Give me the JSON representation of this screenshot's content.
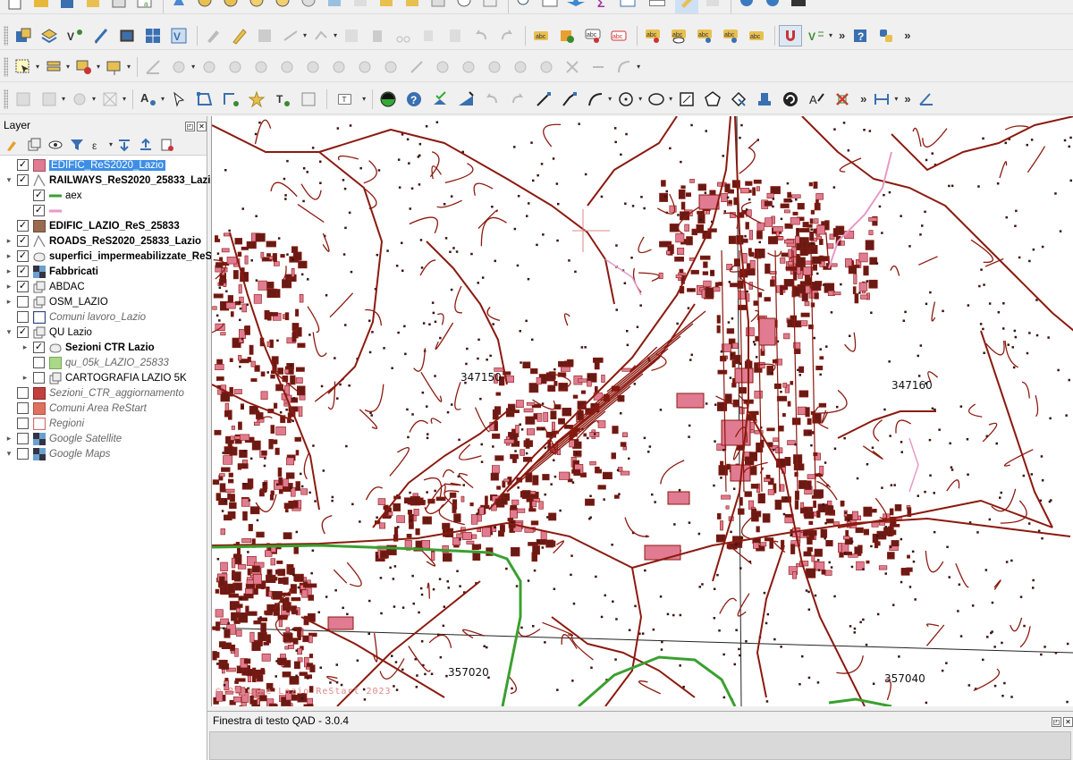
{
  "layer_panel": {
    "title": "Layer",
    "tools": [
      "style-manager-icon",
      "add-group-icon",
      "visibility-icon",
      "filter-legend-icon",
      "expression-filter-icon",
      "expand-all-icon",
      "collapse-all-icon",
      "remove-layer-icon"
    ],
    "layers": [
      {
        "name": "EDIFIC_ReS2020_Lazio",
        "checked": true,
        "expand": "",
        "symbol": "fill-pink",
        "style": "selected",
        "indent": 0
      },
      {
        "name": "RAILWAYS_ReS2020_25833_Lazio",
        "checked": true,
        "expand": "▾",
        "symbol": "line",
        "style": "bold",
        "indent": 0
      },
      {
        "name": "aex",
        "checked": true,
        "expand": "",
        "symbol": "line-green",
        "style": "",
        "indent": 1
      },
      {
        "name": "",
        "checked": true,
        "expand": "",
        "symbol": "line-pink",
        "style": "",
        "indent": 1
      },
      {
        "name": "EDIFIC_LAZIO_ReS_25833",
        "checked": true,
        "expand": "",
        "symbol": "fill-brown",
        "style": "bold",
        "indent": 0
      },
      {
        "name": "ROADS_ReS2020_25833_Lazio",
        "checked": true,
        "expand": "▸",
        "symbol": "line",
        "style": "bold",
        "indent": 0
      },
      {
        "name": "superfici_impermeabilizzate_ReS",
        "checked": true,
        "expand": "▸",
        "symbol": "polygon",
        "style": "bold",
        "indent": 0
      },
      {
        "name": "Fabbricati",
        "checked": true,
        "expand": "▸",
        "symbol": "raster",
        "style": "bold",
        "indent": 0
      },
      {
        "name": "ABDAC",
        "checked": true,
        "expand": "▸",
        "symbol": "group",
        "style": "",
        "indent": 0
      },
      {
        "name": "OSM_LAZIO",
        "checked": false,
        "expand": "▸",
        "symbol": "group",
        "style": "",
        "indent": 0
      },
      {
        "name": "Comuni lavoro_Lazio",
        "checked": false,
        "expand": "",
        "symbol": "fill-outline-blue",
        "style": "italic",
        "indent": 0
      },
      {
        "name": "QU Lazio",
        "checked": true,
        "expand": "▾",
        "symbol": "group",
        "style": "",
        "indent": 0
      },
      {
        "name": "Sezioni CTR Lazio",
        "checked": true,
        "expand": "▸",
        "symbol": "polygon",
        "style": "bold",
        "indent": 1
      },
      {
        "name": "qu_05k_LAZIO_25833",
        "checked": false,
        "expand": "",
        "symbol": "fill-green",
        "style": "italic",
        "indent": 1
      },
      {
        "name": "CARTOGRAFIA LAZIO 5K",
        "checked": false,
        "expand": "▸",
        "symbol": "group",
        "style": "",
        "indent": 1
      },
      {
        "name": "Sezioni_CTR_aggiornamento",
        "checked": false,
        "expand": "",
        "symbol": "fill-red",
        "style": "italic",
        "indent": 0
      },
      {
        "name": "Comuni Area ReStart",
        "checked": false,
        "expand": "",
        "symbol": "fill-lightred",
        "style": "italic",
        "indent": 0
      },
      {
        "name": "Regioni",
        "checked": false,
        "expand": "",
        "symbol": "fill-outline-red",
        "style": "italic",
        "indent": 0
      },
      {
        "name": "Google Satellite",
        "checked": false,
        "expand": "▸",
        "symbol": "raster",
        "style": "italic",
        "indent": 0
      },
      {
        "name": "Google Maps",
        "checked": false,
        "expand": "▾",
        "symbol": "raster",
        "style": "italic",
        "indent": 0
      }
    ]
  },
  "map": {
    "labels": [
      "347150",
      "347160",
      "357020",
      "357040"
    ],
    "watermark": "© Regione Lazio ReStart 2023",
    "colors": {
      "roads": "#8b1a10",
      "buildings": "#e07b91",
      "railway_green": "#3aa030",
      "railway_pink": "#e79ac6",
      "background": "#ffffff"
    }
  },
  "text_window": {
    "title": "Finestra di testo QAD - 3.0.4"
  }
}
